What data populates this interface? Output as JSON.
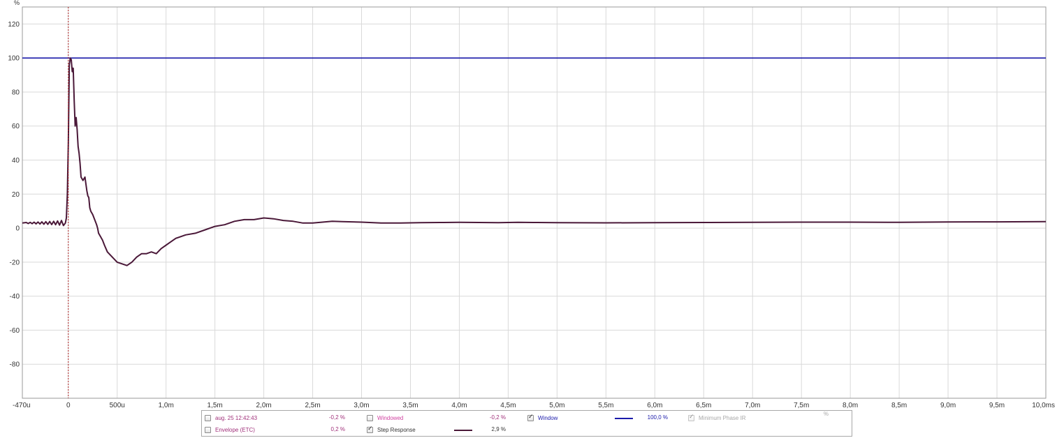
{
  "chart_data": {
    "type": "line",
    "y_unit": "%",
    "x_unit": "ms",
    "xlim": [
      -0.47,
      10.0
    ],
    "ylim": [
      -100,
      130
    ],
    "grid": true,
    "x_ticks": [
      {
        "value": -0.47,
        "label": "-470u"
      },
      {
        "value": 0,
        "label": "0"
      },
      {
        "value": 0.5,
        "label": "500u"
      },
      {
        "value": 1.0,
        "label": "1,0m"
      },
      {
        "value": 1.5,
        "label": "1,5m"
      },
      {
        "value": 2.0,
        "label": "2,0m"
      },
      {
        "value": 2.5,
        "label": "2,5m"
      },
      {
        "value": 3.0,
        "label": "3,0m"
      },
      {
        "value": 3.5,
        "label": "3,5m"
      },
      {
        "value": 4.0,
        "label": "4,0m"
      },
      {
        "value": 4.5,
        "label": "4,5m"
      },
      {
        "value": 5.0,
        "label": "5,0m"
      },
      {
        "value": 5.5,
        "label": "5,5m"
      },
      {
        "value": 6.0,
        "label": "6,0m"
      },
      {
        "value": 6.5,
        "label": "6,5m"
      },
      {
        "value": 7.0,
        "label": "7,0m"
      },
      {
        "value": 7.5,
        "label": "7,5m"
      },
      {
        "value": 8.0,
        "label": "8,0m"
      },
      {
        "value": 8.5,
        "label": "8,5m"
      },
      {
        "value": 9.0,
        "label": "9,0m"
      },
      {
        "value": 9.5,
        "label": "9,5m"
      },
      {
        "value": 10.0,
        "label": "10,0ms"
      }
    ],
    "y_ticks": [
      {
        "value": 120,
        "label": "120"
      },
      {
        "value": 100,
        "label": "100"
      },
      {
        "value": 80,
        "label": "80"
      },
      {
        "value": 60,
        "label": "60"
      },
      {
        "value": 40,
        "label": "40"
      },
      {
        "value": 20,
        "label": "20"
      },
      {
        "value": 0,
        "label": "0"
      },
      {
        "value": -20,
        "label": "-20"
      },
      {
        "value": -40,
        "label": "-40"
      },
      {
        "value": -60,
        "label": "-60"
      },
      {
        "value": -80,
        "label": "-80"
      }
    ],
    "cursor_x": 0,
    "series": [
      {
        "name": "Window",
        "color": "#1a1aaa",
        "x": [
          -0.47,
          10.0
        ],
        "y": [
          100,
          100
        ]
      },
      {
        "name": "Step Response",
        "color": "#4a1838",
        "x": [
          -0.47,
          -0.43,
          -0.41,
          -0.39,
          -0.37,
          -0.35,
          -0.33,
          -0.31,
          -0.29,
          -0.27,
          -0.25,
          -0.23,
          -0.21,
          -0.19,
          -0.17,
          -0.15,
          -0.13,
          -0.11,
          -0.09,
          -0.07,
          -0.05,
          -0.03,
          -0.02,
          -0.01,
          0.0,
          0.01,
          0.02,
          0.03,
          0.04,
          0.05,
          0.06,
          0.07,
          0.08,
          0.09,
          0.1,
          0.11,
          0.12,
          0.13,
          0.15,
          0.17,
          0.19,
          0.2,
          0.21,
          0.22,
          0.23,
          0.25,
          0.27,
          0.29,
          0.3,
          0.31,
          0.33,
          0.35,
          0.37,
          0.4,
          0.45,
          0.5,
          0.55,
          0.6,
          0.65,
          0.7,
          0.75,
          0.8,
          0.85,
          0.9,
          0.95,
          1.0,
          1.05,
          1.1,
          1.2,
          1.3,
          1.4,
          1.5,
          1.6,
          1.7,
          1.8,
          1.9,
          2.0,
          2.1,
          2.2,
          2.3,
          2.4,
          2.5,
          2.6,
          2.7,
          2.8,
          3.0,
          3.2,
          3.4,
          3.6,
          3.8,
          4.0,
          4.2,
          4.4,
          4.6,
          4.8,
          5.0,
          5.5,
          6.0,
          6.5,
          7.0,
          7.5,
          8.0,
          8.5,
          9.0,
          9.5,
          10.0
        ],
        "y": [
          3,
          3.3,
          2.7,
          3.4,
          2.6,
          3.5,
          2.5,
          3.6,
          2.4,
          3.7,
          2.3,
          3.8,
          2.2,
          3.9,
          2.1,
          4.0,
          2.0,
          4.2,
          1.8,
          4.5,
          1.5,
          3,
          6,
          20,
          50,
          96,
          100,
          99,
          92,
          94,
          75,
          60,
          65,
          58,
          48,
          44,
          38,
          30,
          28,
          30,
          22,
          19,
          18,
          12,
          10,
          8,
          5,
          2,
          0,
          -3,
          -5,
          -7,
          -10,
          -14,
          -17,
          -20,
          -21,
          -22,
          -20,
          -17,
          -15,
          -15,
          -14,
          -15,
          -12,
          -10,
          -8,
          -6,
          -4,
          -3,
          -1,
          1,
          2,
          4,
          5,
          5,
          6,
          5.5,
          4.5,
          4,
          3,
          3,
          3.5,
          4,
          3.8,
          3.5,
          3,
          3,
          3.2,
          3.3,
          3.4,
          3.3,
          3.2,
          3.4,
          3.3,
          3.2,
          3.1,
          3.2,
          3.3,
          3.4,
          3.5,
          3.5,
          3.4,
          3.6,
          3.7,
          3.8
        ]
      }
    ]
  },
  "legend": {
    "row1": [
      {
        "label": "aug. 25 12:42:43",
        "value": "-0,2 %",
        "checked": false,
        "disabled": false,
        "color": "#a0307a"
      },
      {
        "label": "Windowed",
        "value": "-0,2 %",
        "checked": false,
        "disabled": false,
        "color": "#d040a0"
      },
      {
        "label": "Window",
        "value": "100,0 %",
        "checked": true,
        "disabled": false,
        "color": "#1a1aaa"
      },
      {
        "label": "Minimum Phase IR",
        "value": "%",
        "checked": true,
        "disabled": true,
        "color": "#a8a8a8"
      }
    ],
    "row2": [
      {
        "label": "Envelope (ETC)",
        "value": "0,2 %",
        "checked": false,
        "disabled": false,
        "color": "#a0307a"
      },
      {
        "label": "Step Response",
        "value": "2,9 %",
        "checked": true,
        "disabled": false,
        "color": "#333333"
      }
    ]
  }
}
